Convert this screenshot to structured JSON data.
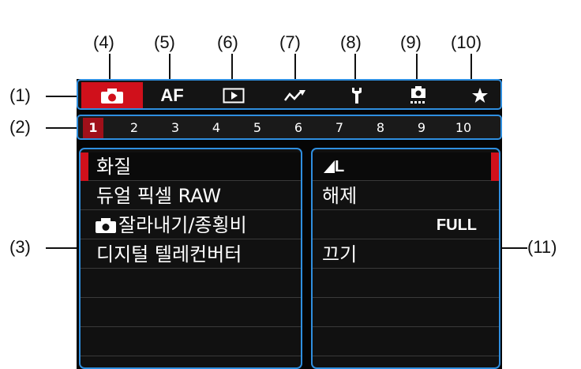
{
  "callouts": {
    "c1": "(1)",
    "c2": "(2)",
    "c3": "(3)",
    "c4": "(4)",
    "c5": "(5)",
    "c6": "(6)",
    "c7": "(7)",
    "c8": "(8)",
    "c9": "(9)",
    "c10": "(10)",
    "c11": "(11)"
  },
  "tabs": [
    {
      "icon": "camera-icon",
      "active": true
    },
    {
      "icon": "af-icon",
      "text": "AF"
    },
    {
      "icon": "playback-icon"
    },
    {
      "icon": "wireless-icon"
    },
    {
      "icon": "wrench-icon"
    },
    {
      "icon": "custom-functions-icon"
    },
    {
      "icon": "star-icon"
    }
  ],
  "pages": [
    "1",
    "2",
    "3",
    "4",
    "5",
    "6",
    "7",
    "8",
    "9",
    "10"
  ],
  "active_page": "1",
  "menu": {
    "items": [
      {
        "label": "화질",
        "value": "L",
        "value_icon": "quality-triangle-icon"
      },
      {
        "label": "듀얼 픽셀 RAW",
        "value": "해제"
      },
      {
        "label": "잘라내기/종횡비",
        "label_icon": "camera-icon",
        "value": "FULL"
      },
      {
        "label": "디지털 텔레컨버터",
        "value": "끄기"
      }
    ]
  },
  "colors": {
    "accent_red": "#d0101b",
    "callout_blue": "#2f8fe0"
  }
}
